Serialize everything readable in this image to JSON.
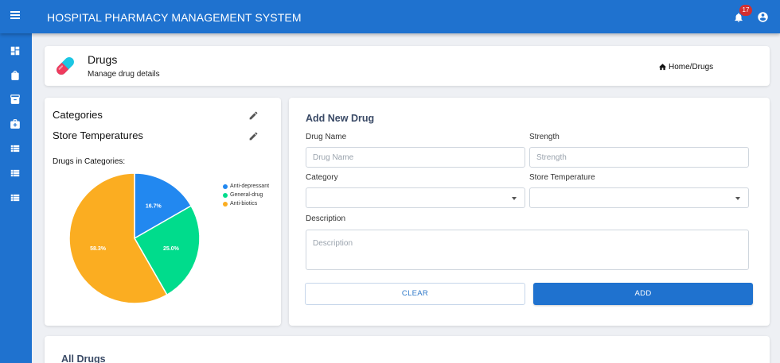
{
  "app": {
    "title": "HOSPITAL PHARMACY MANAGEMENT SYSTEM",
    "notification_count": "17"
  },
  "sidebar": {
    "items": [
      "dashboard-icon",
      "shopping-bag-icon",
      "archive-icon",
      "medical-bag-icon",
      "list-icon",
      "list-icon",
      "list-icon"
    ]
  },
  "page_header": {
    "title": "Drugs",
    "subtitle": "Manage drug details",
    "breadcrumb": "Home/Drugs"
  },
  "left_panel": {
    "categories_label": "Categories",
    "temperatures_label": "Store Temperatures",
    "chart_caption": "Drugs in Categories:"
  },
  "chart_data": {
    "type": "pie",
    "title": "Drugs in Categories:",
    "slices": [
      {
        "name": "Anti-depressant",
        "value": 16.7,
        "label": "16.7%",
        "color": "#2288f0"
      },
      {
        "name": "General-drug",
        "value": 25.0,
        "label": "25.0%",
        "color": "#00dc8c"
      },
      {
        "name": "Anti-biotics",
        "value": 58.3,
        "label": "58.3%",
        "color": "#fbad21"
      }
    ],
    "legend_placement": "right"
  },
  "form": {
    "title": "Add New Drug",
    "drug_name_label": "Drug Name",
    "drug_name_placeholder": "Drug Name",
    "strength_label": "Strength",
    "strength_placeholder": "Strength",
    "category_label": "Category",
    "category_value": "",
    "temperature_label": "Store Temperature",
    "temperature_value": "",
    "description_label": "Description",
    "description_placeholder": "Description",
    "clear_label": "CLEAR",
    "add_label": "ADD"
  },
  "all_drugs": {
    "title": "All Drugs"
  }
}
